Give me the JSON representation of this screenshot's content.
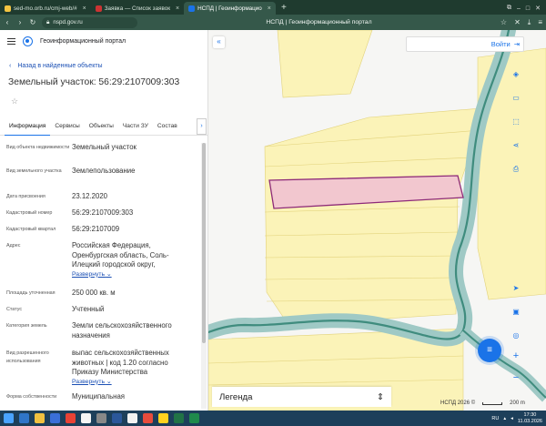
{
  "browser": {
    "tabs": [
      {
        "label": "sed-mo.orb.ru/cmj-web/#",
        "fav": "#f5c542",
        "active": false
      },
      {
        "label": "Заявка — Список заявок",
        "fav": "#c33",
        "active": false
      },
      {
        "label": "НСПД | Геоинформацио",
        "fav": "#1a73e8",
        "active": true
      }
    ],
    "url": "nspd.gov.ru",
    "page_title": "НСПД | Геоинформационный портал"
  },
  "panel": {
    "brand": "Геоинформационный портал",
    "back_label": "Назад в найденные объекты",
    "title": "Земельный участок: 56:29:2107009:303",
    "tabs": [
      "Информация",
      "Сервисы",
      "Объекты",
      "Части ЗУ",
      "Состав"
    ],
    "properties": [
      {
        "label": "Вид объекта недвижимости",
        "value": "Земельный участок"
      },
      {
        "label": "Вид земельного участка",
        "value": "Землепользование"
      },
      {
        "label": "Дата присвоения",
        "value": "23.12.2020"
      },
      {
        "label": "Кадастровый номер",
        "value": "56:29:2107009:303"
      },
      {
        "label": "Кадастровый квартал",
        "value": "56:29:2107009"
      },
      {
        "label": "Адрес",
        "value": "Российская Федерация, Оренбургская область, Соль-Илецкий городской округ,",
        "expand": "Развернуть"
      },
      {
        "label": "Площадь уточненная",
        "value": "250 000 кв. м"
      },
      {
        "label": "Статус",
        "value": "Учтенный"
      },
      {
        "label": "Категория земель",
        "value": "Земли сельскохозяйственного назначения"
      },
      {
        "label": "Вид разрешенного использования",
        "value": "выпас сельскохозяйственных животных | код 1.20 согласно Приказу Министерства",
        "expand": "Развернуть"
      },
      {
        "label": "Форма собственности",
        "value": "Муниципальная"
      }
    ]
  },
  "map": {
    "login_label": "Войти",
    "legend_label": "Легенда",
    "attribution": "НСПД 2026 ©",
    "scale_label": "200 m"
  },
  "taskbar": {
    "lang": "RU",
    "time": "17:30",
    "date": "11.03.2026"
  }
}
